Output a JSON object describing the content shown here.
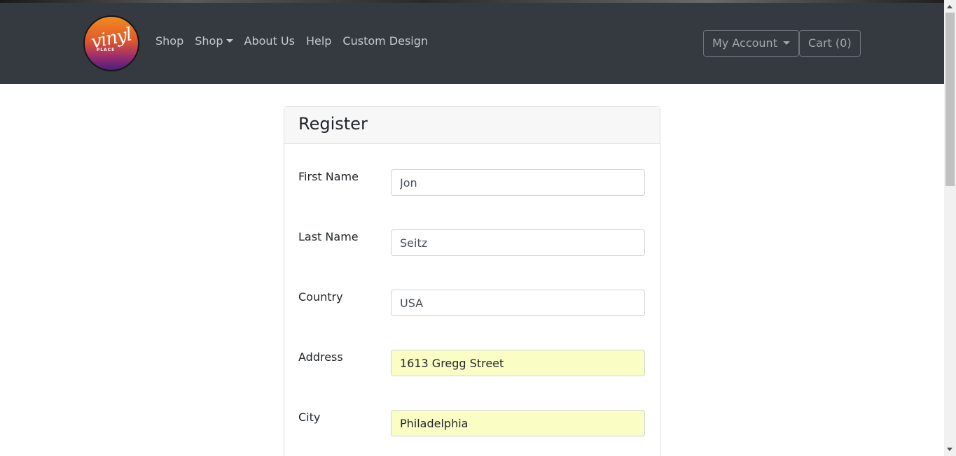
{
  "brand": {
    "logo_text": "vinyl",
    "logo_sub": "PLACE"
  },
  "nav": {
    "links": [
      "Shop",
      "Shop",
      "About Us",
      "Help",
      "Custom Design"
    ],
    "account_label": "My Account",
    "cart_label": "Cart (0)"
  },
  "form": {
    "title": "Register",
    "fields": [
      {
        "label": "First Name",
        "value": "Jon"
      },
      {
        "label": "Last Name",
        "value": "Seitz"
      },
      {
        "label": "Country",
        "value": "USA"
      },
      {
        "label": "Address",
        "value": "1613 Gregg Street"
      },
      {
        "label": "City",
        "value": "Philadelphia"
      }
    ]
  },
  "colors": {
    "navbar": "#343a40",
    "autofill": "#fafdc4"
  }
}
